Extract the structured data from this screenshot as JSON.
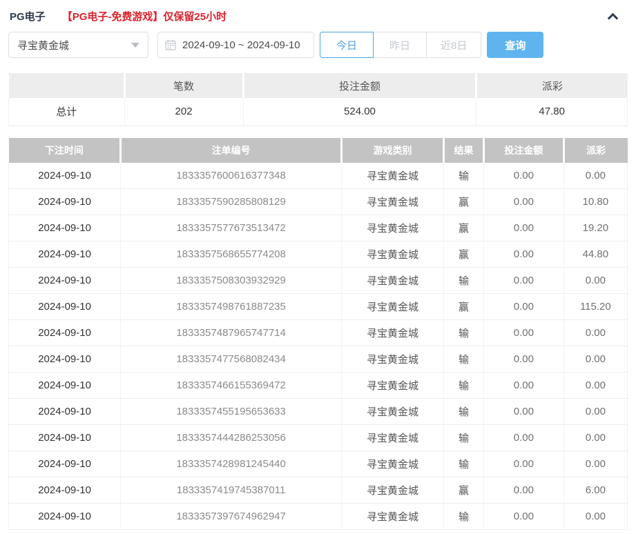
{
  "header": {
    "title": "PG电子",
    "notice": "【PG电子-免费游戏】仅保留25小时",
    "collapse_icon": "chevron-up-icon"
  },
  "filters": {
    "game_select": {
      "value": "寻宝黄金城",
      "caret_icon": "caret-down-icon"
    },
    "date_range": {
      "value": "2024-09-10 ~ 2024-09-10",
      "icon": "calendar-icon"
    },
    "quick_buttons": [
      {
        "label": "今日",
        "active": true
      },
      {
        "label": "昨日",
        "active": false
      },
      {
        "label": "近8日",
        "active": false
      }
    ],
    "search_label": "查询"
  },
  "summary": {
    "headers": [
      "",
      "笔数",
      "投注金额",
      "派彩"
    ],
    "row": {
      "label": "总计",
      "count": "202",
      "bet_amount": "524.00",
      "payout": "47.80"
    }
  },
  "table": {
    "headers": [
      "下注时间",
      "注单编号",
      "游戏类别",
      "结果",
      "投注金额",
      "派彩"
    ],
    "rows": [
      [
        "2024-09-10",
        "1833357600616377348",
        "寻宝黄金城",
        "输",
        "0.00",
        "0.00"
      ],
      [
        "2024-09-10",
        "1833357590285808129",
        "寻宝黄金城",
        "赢",
        "0.00",
        "10.80"
      ],
      [
        "2024-09-10",
        "1833357577673513472",
        "寻宝黄金城",
        "赢",
        "0.00",
        "19.20"
      ],
      [
        "2024-09-10",
        "1833357568655774208",
        "寻宝黄金城",
        "赢",
        "0.00",
        "44.80"
      ],
      [
        "2024-09-10",
        "1833357508303932929",
        "寻宝黄金城",
        "输",
        "0.00",
        "0.00"
      ],
      [
        "2024-09-10",
        "1833357498761887235",
        "寻宝黄金城",
        "赢",
        "0.00",
        "115.20"
      ],
      [
        "2024-09-10",
        "1833357487965747714",
        "寻宝黄金城",
        "输",
        "0.00",
        "0.00"
      ],
      [
        "2024-09-10",
        "1833357477568082434",
        "寻宝黄金城",
        "输",
        "0.00",
        "0.00"
      ],
      [
        "2024-09-10",
        "1833357466155369472",
        "寻宝黄金城",
        "输",
        "0.00",
        "0.00"
      ],
      [
        "2024-09-10",
        "1833357455195653633",
        "寻宝黄金城",
        "输",
        "0.00",
        "0.00"
      ],
      [
        "2024-09-10",
        "1833357444286253056",
        "寻宝黄金城",
        "输",
        "0.00",
        "0.00"
      ],
      [
        "2024-09-10",
        "1833357428981245440",
        "寻宝黄金城",
        "输",
        "0.00",
        "0.00"
      ],
      [
        "2024-09-10",
        "1833357419745387011",
        "寻宝黄金城",
        "赢",
        "0.00",
        "6.00"
      ],
      [
        "2024-09-10",
        "1833357397674962947",
        "寻宝黄金城",
        "输",
        "0.00",
        "0.00"
      ]
    ]
  },
  "colors": {
    "accent_blue": "#5fb4f0",
    "active_tab_blue": "#4aa3e8",
    "notice_red": "#d9232e",
    "table_header_gray": "#c3c3c3",
    "summary_header_gray": "#ededed"
  }
}
